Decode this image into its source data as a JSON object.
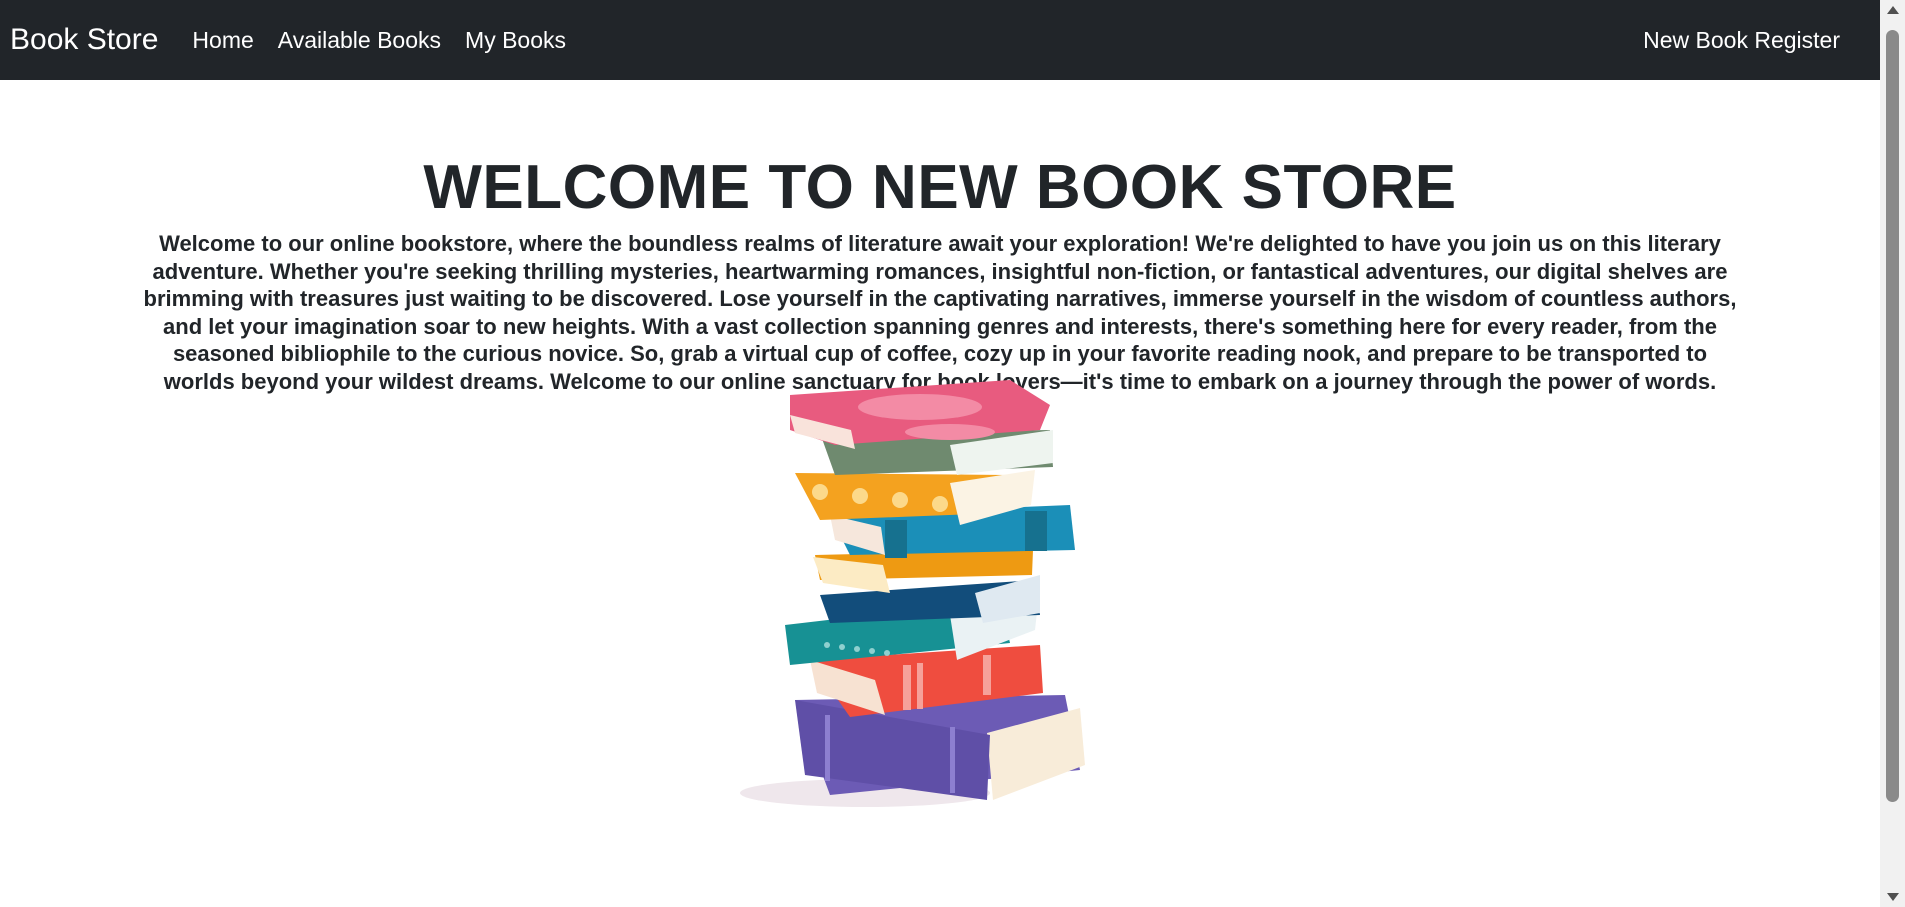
{
  "navbar": {
    "brand": "Book Store",
    "links": [
      "Home",
      "Available Books",
      "My Books"
    ],
    "right_link": "New Book Register"
  },
  "main": {
    "title": "WELCOME TO NEW BOOK STORE",
    "intro": "Welcome to our online bookstore, where the boundless realms of literature await your exploration! We're delighted to have you join us on this literary adventure. Whether you're seeking thrilling mysteries, heartwarming romances, insightful non-fiction, or fantastical adventures, our digital shelves are brimming with treasures just waiting to be discovered. Lose yourself in the captivating narratives, immerse yourself in the wisdom of countless authors, and let your imagination soar to new heights. With a vast collection spanning genres and interests, there's something here for every reader, from the seasoned bibliophile to the curious novice. So, grab a virtual cup of coffee, cozy up in your favorite reading nook, and prepare to be transported to worlds beyond your wildest dreams. Welcome to our online sanctuary for book lovers—it's time to embark on a journey through the power of words."
  },
  "colors": {
    "navbar_bg": "#212529",
    "text": "#212529"
  }
}
